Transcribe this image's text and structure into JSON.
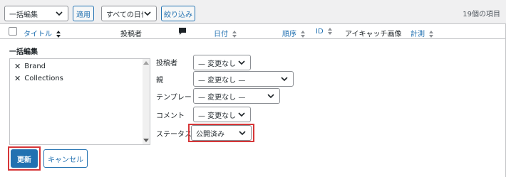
{
  "toolbar": {
    "bulk_action": "一括編集",
    "apply": "適用",
    "date_filter": "すべての日付",
    "filter": "絞り込み",
    "item_count": "19個の項目"
  },
  "columns": {
    "title": "タイトル",
    "author": "投稿者",
    "comments_icon": "comment-icon",
    "date": "日付",
    "order": "順序",
    "id": "ID",
    "thumbnail": "アイキャッチ画像",
    "measure": "計測"
  },
  "bulk_edit": {
    "title": "一括編集",
    "items": [
      "Brand",
      "Collections"
    ],
    "fields": {
      "author_label": "投稿者",
      "author_value": "— 変更なし —",
      "parent_label": "親",
      "parent_value": "— 変更なし —",
      "template_label": "テンプレート",
      "template_value": "— 変更なし —",
      "comment_label": "コメント",
      "comment_value": "— 変更なし —",
      "status_label": "ステータス",
      "status_value": "公開済み"
    },
    "update_button": "更新",
    "cancel_button": "キャンセル"
  },
  "colors": {
    "accent": "#2271b1",
    "highlight": "#d63638"
  }
}
